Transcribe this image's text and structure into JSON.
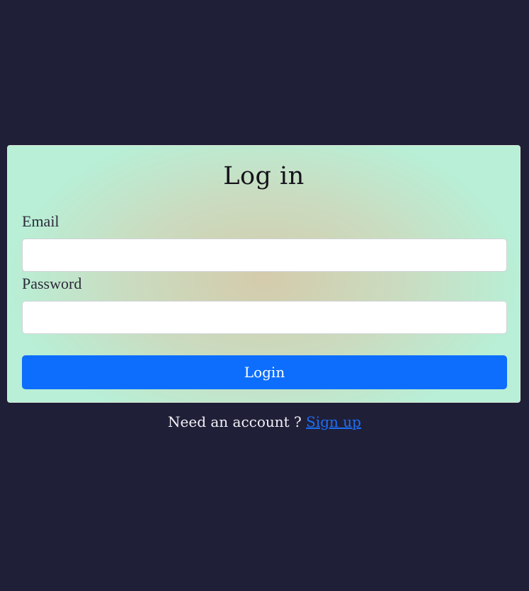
{
  "login_form": {
    "title": "Log in",
    "email": {
      "label": "Email",
      "value": "",
      "placeholder": ""
    },
    "password": {
      "label": "Password",
      "value": "",
      "placeholder": ""
    },
    "submit_label": "Login"
  },
  "footer": {
    "prompt": "Need an account ?",
    "link_label": "Sign up"
  },
  "colors": {
    "page_background": "#201f38",
    "primary_button": "#0d6efd",
    "link": "#1d6ff5"
  }
}
